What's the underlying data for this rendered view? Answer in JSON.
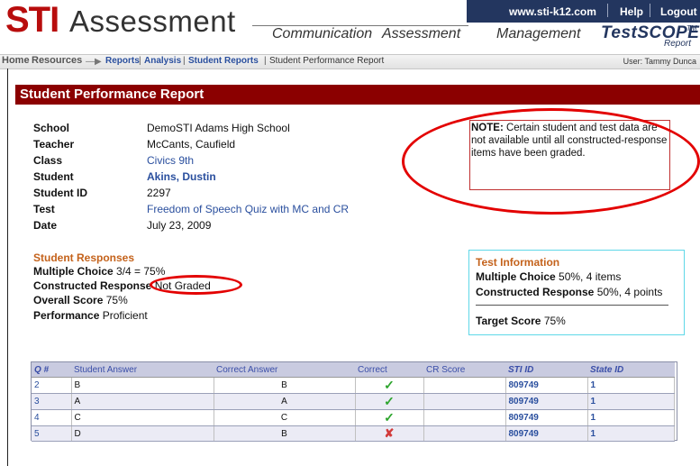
{
  "app": {
    "logo_sti": "STI",
    "logo_assessment": "Assessment",
    "top_links": [
      "www.sti-k12.com",
      "Help",
      "Logout"
    ],
    "nav_tabs": [
      "Communication",
      "Assessment",
      "Management"
    ],
    "testscope": "TestSCOPE",
    "testscope_tm": "TM",
    "testscope_sub": "Report"
  },
  "breadcrumb": {
    "home": "Home",
    "resources": "Resources",
    "reports": "Reports",
    "analysis": "Analysis",
    "student_reports": "Student Reports",
    "current": "Student Performance Report",
    "user": "User: Tammy Dunca"
  },
  "report": {
    "title": "Student Performance Report",
    "labels": {
      "school": "School",
      "teacher": "Teacher",
      "class": "Class",
      "student": "Student",
      "student_id": "Student ID",
      "test": "Test",
      "date": "Date"
    },
    "values": {
      "school": "DemoSTI Adams High School",
      "teacher": "McCants, Caufield",
      "class": "Civics 9th",
      "student": "Akins, Dustin",
      "student_id": "2297",
      "test": "Freedom of Speech Quiz with MC and CR",
      "date": "July 23, 2009"
    },
    "note_label": "NOTE:",
    "note_text": "Certain student and test data are not available until all constructed-response items have been graded."
  },
  "responses": {
    "heading": "Student Responses",
    "mc_label": "Multiple Choice",
    "mc_value": "3/4 = 75%",
    "cr_label": "Constructed Response",
    "cr_value": "Not Graded",
    "overall_label": "Overall Score",
    "overall_value": "75%",
    "perf_label": "Performance",
    "perf_value": "Proficient"
  },
  "test_info": {
    "heading": "Test Information",
    "mc_label": "Multiple Choice",
    "mc_value": "50%, 4 items",
    "cr_label": "Constructed Response",
    "cr_value": "50%, 4 points",
    "target_label": "Target Score",
    "target_value": "75%"
  },
  "table": {
    "columns": [
      "Q #",
      "Student Answer",
      "Correct Answer",
      "Correct",
      "CR Score",
      "STI ID",
      "State ID"
    ],
    "rows": [
      {
        "q": "2",
        "student": "B",
        "correct": "B",
        "mark": "✓",
        "cr": "",
        "sti": "809749",
        "state": "1"
      },
      {
        "q": "3",
        "student": "A",
        "correct": "A",
        "mark": "✓",
        "cr": "",
        "sti": "809749",
        "state": "1"
      },
      {
        "q": "4",
        "student": "C",
        "correct": "C",
        "mark": "✓",
        "cr": "",
        "sti": "809749",
        "state": "1"
      },
      {
        "q": "5",
        "student": "D",
        "correct": "B",
        "mark": "✘",
        "cr": "",
        "sti": "809749",
        "state": "1"
      }
    ]
  },
  "colors": {
    "brand_red": "#b80d0d",
    "title_bar": "#8b0000",
    "nav_blue": "#23365f",
    "link_blue": "#2a4f9e",
    "heading_orange": "#c4621b",
    "annotation_red": "#e30000"
  }
}
